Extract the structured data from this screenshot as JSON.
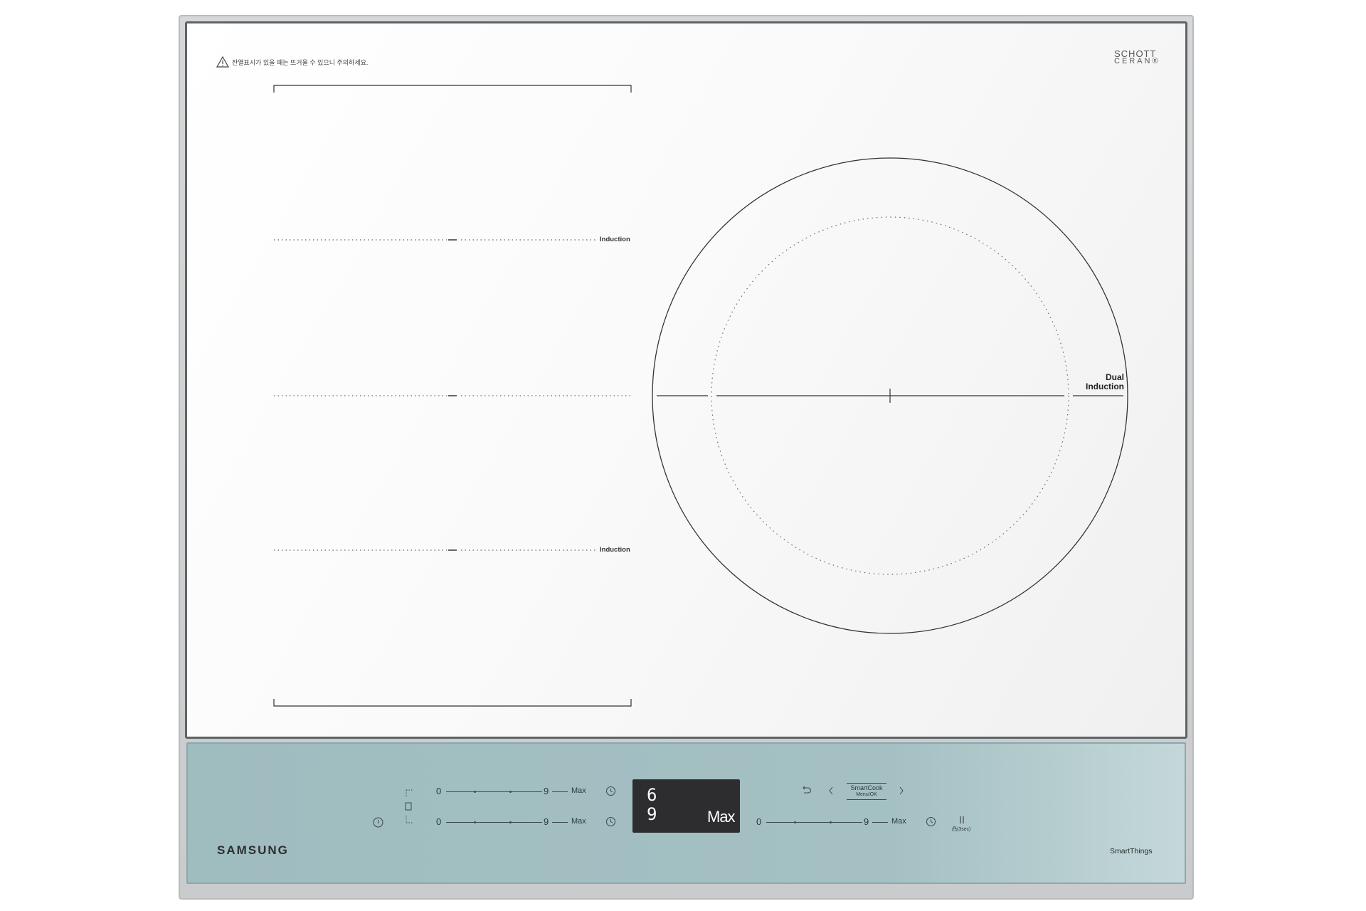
{
  "warning_text": "잔열표시가 있을 때는 뜨거울 수 있으니 주의하세요.",
  "glass_logo": {
    "line1": "SCHOTT",
    "line2": "CERAN®"
  },
  "zones": {
    "top_label": "Induction",
    "bottom_label": "Induction",
    "dual_line1": "Dual",
    "dual_line2": "Induction"
  },
  "controls": {
    "row1": {
      "min": "0",
      "mid": "9",
      "max": "Max"
    },
    "row2": {
      "min": "0",
      "mid": "9",
      "max": "Max"
    },
    "row3": {
      "min": "0",
      "mid": "9",
      "max": "Max"
    },
    "smartcook_label": "SmartCook",
    "smartcook_sub": "Menu/OK",
    "lock_label": "(3sec)"
  },
  "display": {
    "top_digit": "6",
    "bottom_digit": "9",
    "level": "Max"
  },
  "brand": "SAMSUNG",
  "smartthings": "SmartThings",
  "colors": {
    "panel": "#a4c0c3",
    "display": "#2d2d2f",
    "glass": "#f7f7f7"
  }
}
